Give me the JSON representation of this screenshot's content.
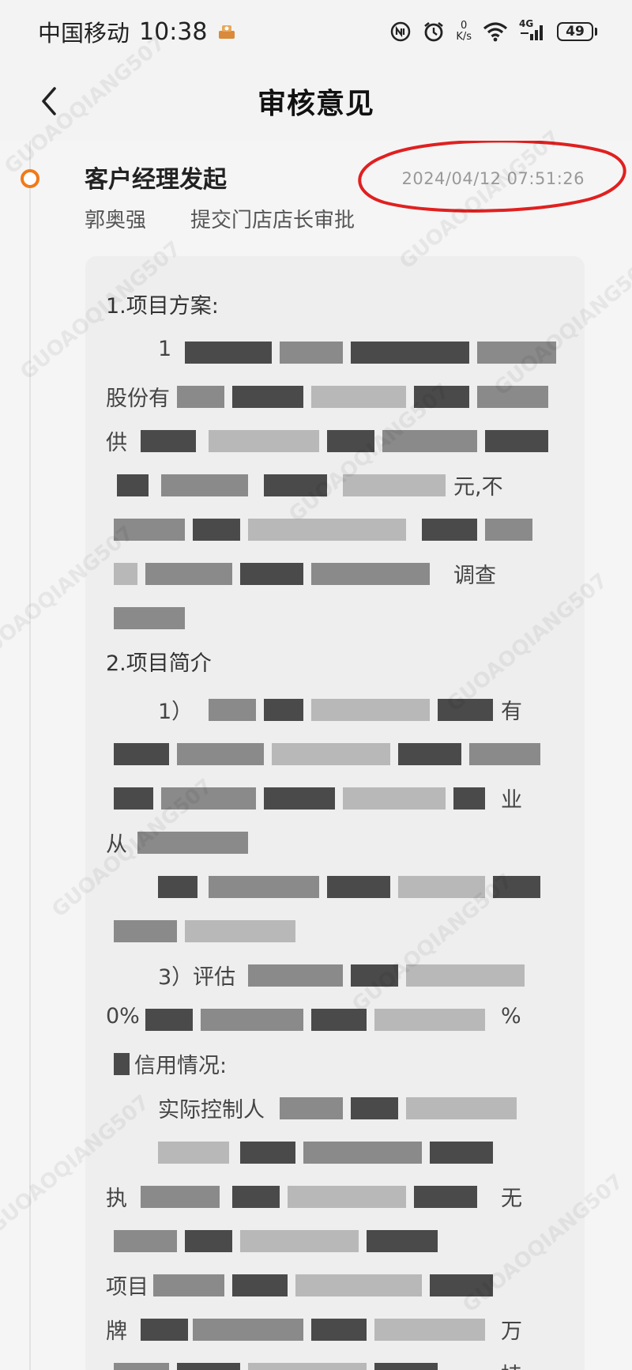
{
  "status_bar": {
    "carrier": "中国移动",
    "time": "10:38",
    "speed_value": "0",
    "speed_unit": "K/s",
    "network": "4G",
    "battery": "49"
  },
  "header": {
    "title": "审核意见"
  },
  "timeline": {
    "node_title": "客户经理发起",
    "timestamp": "2024/04/12 07:51:26",
    "operator": "郭奥强",
    "action": "提交门店店长审批"
  },
  "opinion": {
    "sections": [
      "1.项目方案:",
      "2.项目简介"
    ],
    "fragments": {
      "l1": "1",
      "l2": "股份有",
      "l3": "供",
      "l4_end": "元,不",
      "l6_end": "调查",
      "l9": "1）",
      "l9_end": "有",
      "l11_end": "业",
      "l12": "从",
      "l15": "3）评估",
      "l16": "0%",
      "l16_end": "%",
      "l17": "信用情况:",
      "l18": "实际控制人",
      "l20": "执",
      "l20_end": "无",
      "l22": "项目",
      "l23": "牌",
      "l23_end": "万",
      "l24_end": "持"
    }
  },
  "watermark": "GUOAOQIANG507",
  "colors": {
    "accent": "#f07a1a",
    "annotation": "#e02020"
  }
}
